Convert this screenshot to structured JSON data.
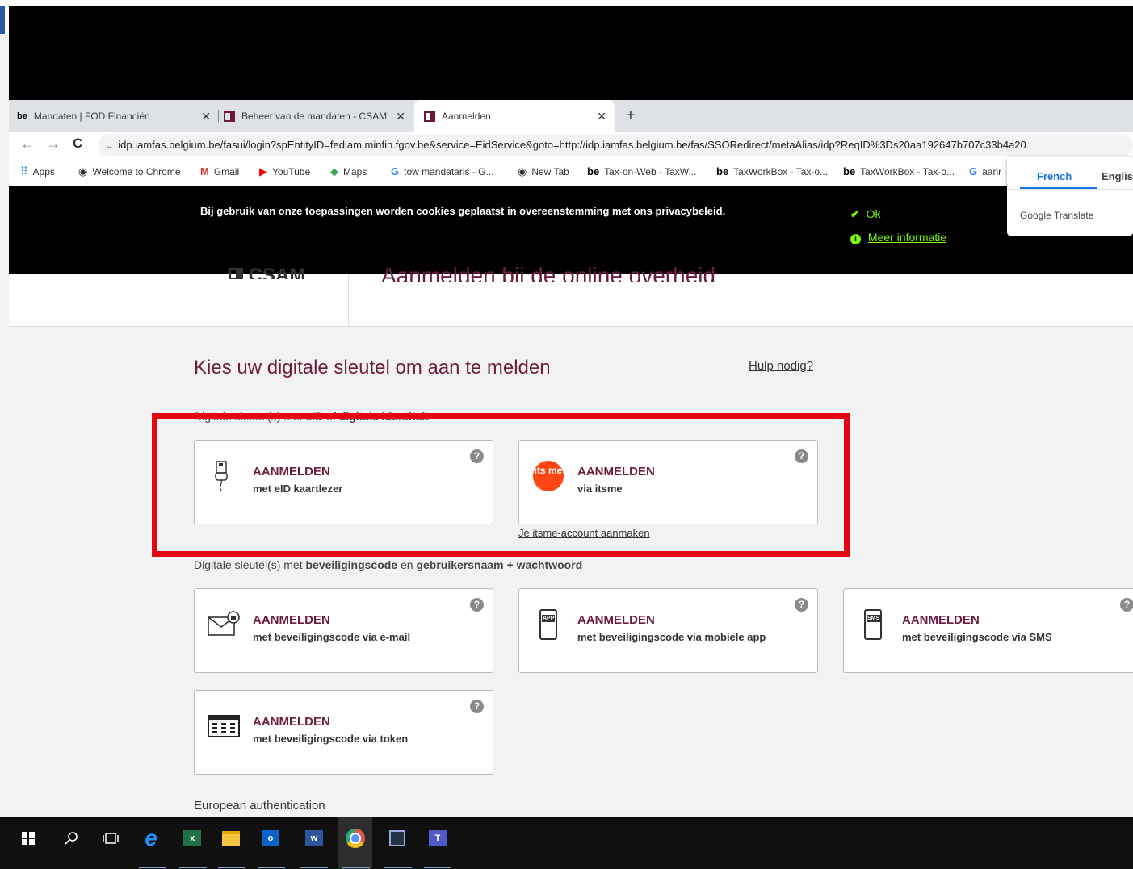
{
  "browser": {
    "tabs": [
      {
        "label": "Mandaten | FOD Financiën",
        "favicon": "be-favicon"
      },
      {
        "label": "Beheer van de mandaten - CSAM",
        "favicon": "csam-favicon"
      },
      {
        "label": "Aanmelden",
        "favicon": "csam-favicon",
        "active": true
      }
    ],
    "new_tab": "+",
    "url": "idp.iamfas.belgium.be/fasui/login?spEntityID=fediam.minfin.fgov.be&service=EidService&goto=http://idp.iamfas.belgium.be/fas/SSORedirect/metaAlias/idp?ReqID%3Ds20aa192647b707c33b4a20",
    "bookmarks": [
      {
        "label": "Apps",
        "icon": "apps-grid-icon"
      },
      {
        "label": "Welcome to Chrome",
        "icon": "globe-icon"
      },
      {
        "label": "Gmail",
        "icon": "gmail-icon"
      },
      {
        "label": "YouTube",
        "icon": "youtube-icon"
      },
      {
        "label": "Maps",
        "icon": "maps-icon"
      },
      {
        "label": "tow mandataris - G...",
        "icon": "google-icon"
      },
      {
        "label": "New Tab",
        "icon": "globe-icon"
      },
      {
        "label": "Tax-on-Web - TaxW...",
        "icon": "be-favicon"
      },
      {
        "label": "TaxWorkBox - Tax-o...",
        "icon": "be-favicon"
      },
      {
        "label": "TaxWorkBox - Tax-o...",
        "icon": "be-favicon"
      },
      {
        "label": "aanr",
        "icon": "google-icon"
      }
    ],
    "be_label": "be"
  },
  "translate": {
    "french": "French",
    "english": "English",
    "brand": "Google Translate"
  },
  "cookie": {
    "message": "Bij gebruik van onze toepassingen worden cookies geplaatst in overeenstemming met ons privacybeleid.",
    "ok": "Ok",
    "more": "Meer informatie"
  },
  "header": {
    "logo_text": "CSAM",
    "title": "Aanmelden bij de online overheid"
  },
  "main": {
    "heading": "Kies uw digitale sleutel om aan te melden",
    "help_link": "Hulp nodig?",
    "section1_prefix": "Digitale sleutel(s) met ",
    "section1_b1": "eID",
    "section1_mid": " of ",
    "section1_b2": "digitale identiteit",
    "section2_prefix": "Digitale sleutel(s) met ",
    "section2_b1": "beveiligingscode",
    "section2_mid": " en ",
    "section2_b2": "gebruikersnaam + wachtwoord",
    "itsme_create": "Je itsme-account aanmaken",
    "european": "European authentication",
    "help_glyph": "?",
    "itsme_logo_text": "its me",
    "app_badge": "APP",
    "sms_badge": "SMS",
    "cards": [
      {
        "title": "AANMELDEN",
        "subtitle": "met eID kaartlezer"
      },
      {
        "title": "AANMELDEN",
        "subtitle": "via itsme"
      },
      {
        "title": "AANMELDEN",
        "subtitle": "met beveiligingscode via e-mail"
      },
      {
        "title": "AANMELDEN",
        "subtitle": "met beveiligingscode via mobiele app"
      },
      {
        "title": "AANMELDEN",
        "subtitle": "met beveiligingscode via SMS"
      },
      {
        "title": "AANMELDEN",
        "subtitle": "met beveiligingscode via token"
      }
    ]
  },
  "colors": {
    "brand": "#6d1d3f",
    "highlight": "#e30613",
    "cookie_link": "#7cfc00"
  }
}
